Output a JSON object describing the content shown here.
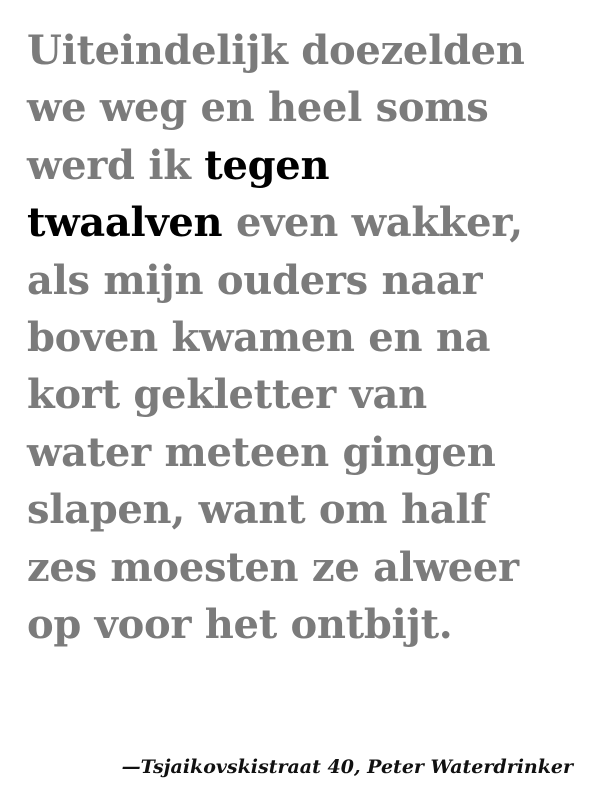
{
  "quote": {
    "lines": [
      [
        {
          "text": "Uiteindelijk doezelden"
        }
      ],
      [
        {
          "text": "we weg en heel soms"
        }
      ],
      [
        {
          "text": "werd ik "
        },
        {
          "text": "tegen",
          "emphasis": true
        }
      ],
      [
        {
          "text": "twaalven",
          "emphasis": true
        },
        {
          "text": " even wakker,"
        }
      ],
      [
        {
          "text": "als mijn ouders naar"
        }
      ],
      [
        {
          "text": "boven kwamen en na"
        }
      ],
      [
        {
          "text": "kort gekletter van"
        }
      ],
      [
        {
          "text": "water meteen gingen"
        }
      ],
      [
        {
          "text": "slapen, want om half"
        }
      ],
      [
        {
          "text": "zes moesten ze alweer"
        }
      ],
      [
        {
          "text": "op voor het ontbijt."
        }
      ]
    ]
  },
  "attribution": {
    "text": "—Tsjaikovskistraat 40, Peter Waterdrinker"
  },
  "colors": {
    "text_muted": "#7b7b7b",
    "text_emphasis": "#000000",
    "background": "#ffffff"
  }
}
